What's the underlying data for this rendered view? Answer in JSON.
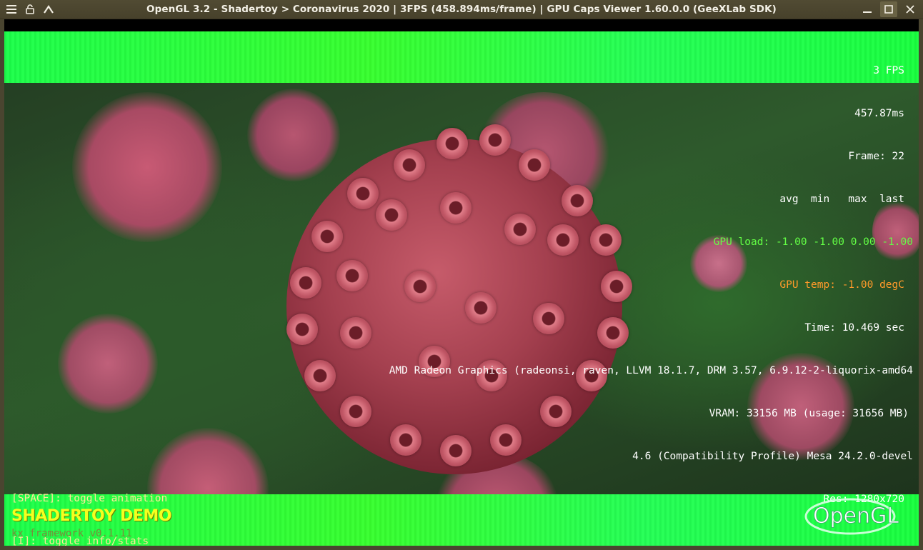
{
  "window": {
    "title": "OpenGL 3.2 - Shadertoy > Coronavirus 2020 | 3FPS (458.894ms/frame) | GPU Caps Viewer 1.60.0.0 (GeeXLab SDK)",
    "left_icons": [
      "menu-icon",
      "pin-icon",
      "keep-above-icon"
    ],
    "right_icons": [
      "minimize-icon",
      "maximize-icon",
      "close-icon"
    ]
  },
  "stats": {
    "fps": "3 FPS",
    "ms": "457.87ms",
    "frame": "Frame: 22",
    "header": "avg  min   max  last",
    "gpu_load": "GPU load: -1.00 -1.00 0.00 -1.00",
    "gpu_temp": "GPU temp: -1.00 degC",
    "time": "Time: 10.469 sec",
    "renderer": "AMD Radeon Graphics (radeonsi, raven, LLVM 18.1.7, DRM 3.57, 6.9.12-2-liquorix-amd64",
    "vram": "VRAM: 33156 MB (usage: 31656 MB)",
    "gl_version": "4.6 (Compatibility Profile) Mesa 24.2.0-devel",
    "res": "Res: 1280x720"
  },
  "hints": {
    "space": "[SPACE]: toggle animation",
    "info": "[I]: toggle info/stats"
  },
  "demo": {
    "title": "SHADERTOY DEMO",
    "framework": "kx framework v0.1.11",
    "logo_text": "OpenGL"
  },
  "colors": {
    "band_green": "#1bff4a",
    "stat_green": "#63ff45",
    "stat_orange": "#ff9a2a",
    "hint_yellow": "#ffe79a",
    "demo_title_yellow": "#f5ff1e"
  }
}
